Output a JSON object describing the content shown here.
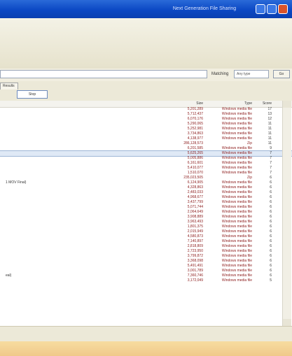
{
  "window": {
    "title": "Next Generation File Sharing"
  },
  "search": {
    "value": "",
    "label": "Matching",
    "select_value": "Any type",
    "go_label": "Go"
  },
  "tabs": {
    "results_label": "Results",
    "stop_label": "Stop"
  },
  "grid": {
    "columns": {
      "size": "Size",
      "type": "Type",
      "score": "Score"
    },
    "rows": [
      {
        "left": "",
        "size": "5,201,289",
        "type": "Windows media file",
        "score": "17"
      },
      {
        "left": "",
        "size": "5,712,437",
        "type": "Windows media file",
        "score": "13"
      },
      {
        "left": "",
        "size": "6,070,176",
        "type": "Windows media file",
        "score": "12"
      },
      {
        "left": "",
        "size": "5,290,065",
        "type": "Windows media file",
        "score": "11"
      },
      {
        "left": "",
        "size": "5,252,981",
        "type": "Windows media file",
        "score": "11"
      },
      {
        "left": "",
        "size": "3,734,863",
        "type": "Windows media file",
        "score": "11"
      },
      {
        "left": "",
        "size": "4,138,977",
        "type": "Windows media file",
        "score": "11"
      },
      {
        "left": "",
        "size": "286,128,573",
        "type": "Zip",
        "score": "11"
      },
      {
        "left": "",
        "size": "6,201,585",
        "type": "Windows media file",
        "score": "9"
      },
      {
        "left": "",
        "size": "5,625,265",
        "type": "Windows media file",
        "score": "7",
        "selected": true
      },
      {
        "left": "",
        "size": "5,005,886",
        "type": "Windows media file",
        "score": "7"
      },
      {
        "left": "",
        "size": "6,161,601",
        "type": "Windows media file",
        "score": "7"
      },
      {
        "left": "",
        "size": "5,410,077",
        "type": "Windows media file",
        "score": "7"
      },
      {
        "left": "",
        "size": "1,510,070",
        "type": "Windows media file",
        "score": "7"
      },
      {
        "left": "",
        "size": "235,023,505",
        "type": "Zip",
        "score": "6"
      },
      {
        "left": "1 MOV Final)",
        "size": "6,124,905",
        "type": "Windows media file",
        "score": "6"
      },
      {
        "left": "",
        "size": "4,328,863",
        "type": "Windows media file",
        "score": "6"
      },
      {
        "left": "",
        "size": "2,483,033",
        "type": "Windows media file",
        "score": "6"
      },
      {
        "left": "",
        "size": "4,968,677",
        "type": "Windows media file",
        "score": "6"
      },
      {
        "left": "",
        "size": "3,437,799",
        "type": "Windows media file",
        "score": "6"
      },
      {
        "left": "",
        "size": "5,071,744",
        "type": "Windows media file",
        "score": "6"
      },
      {
        "left": "",
        "size": "2,064,649",
        "type": "Windows media file",
        "score": "6"
      },
      {
        "left": "",
        "size": "3,908,889",
        "type": "Windows media file",
        "score": "6"
      },
      {
        "left": "",
        "size": "3,963,493",
        "type": "Windows media file",
        "score": "6"
      },
      {
        "left": "",
        "size": "1,801,375",
        "type": "Windows media file",
        "score": "6"
      },
      {
        "left": "",
        "size": "2,015,949",
        "type": "Windows media file",
        "score": "6"
      },
      {
        "left": "",
        "size": "4,580,873",
        "type": "Windows media file",
        "score": "6"
      },
      {
        "left": "",
        "size": "7,140,897",
        "type": "Windows media file",
        "score": "6"
      },
      {
        "left": "",
        "size": "2,818,809",
        "type": "Windows media file",
        "score": "6"
      },
      {
        "left": "",
        "size": "2,723,950",
        "type": "Windows media file",
        "score": "6"
      },
      {
        "left": "",
        "size": "3,799,872",
        "type": "Windows media file",
        "score": "6"
      },
      {
        "left": "",
        "size": "3,368,098",
        "type": "Windows media file",
        "score": "6"
      },
      {
        "left": "",
        "size": "5,491,491",
        "type": "Windows media file",
        "score": "6"
      },
      {
        "left": "",
        "size": "3,001,789",
        "type": "Windows media file",
        "score": "6"
      },
      {
        "left": "eal)",
        "size": "7,360,746",
        "type": "Windows media file",
        "score": "6"
      },
      {
        "left": "",
        "size": "3,172,049",
        "type": "Windows media file",
        "score": "5"
      }
    ]
  },
  "colors": {
    "titlebar": "#0b48c4",
    "size_text": "#8b1a1a",
    "selection": "#dfe9f6"
  }
}
